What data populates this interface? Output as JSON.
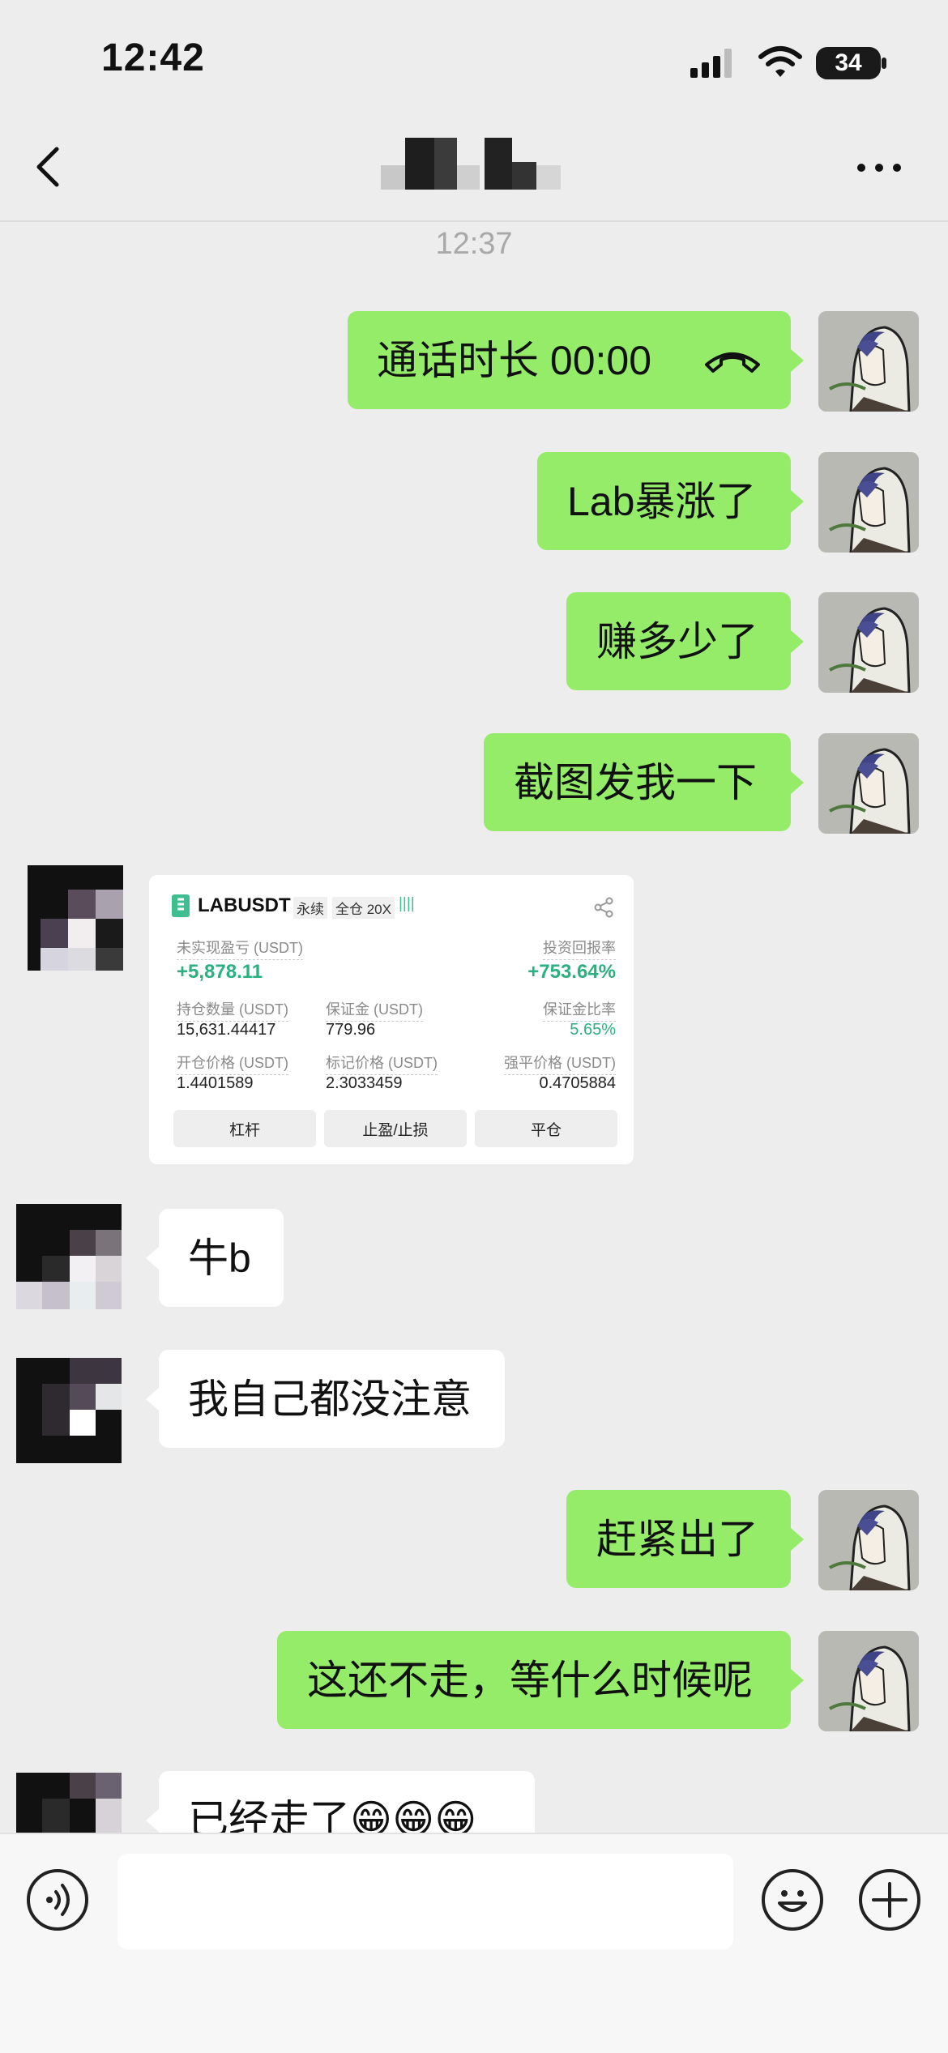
{
  "status_bar": {
    "time": "12:42",
    "battery": "34"
  },
  "chat": {
    "timestamp": "12:37",
    "messages": [
      {
        "side": "out",
        "text": "通话时长 00:00",
        "icon": "phone-hangup-icon"
      },
      {
        "side": "out",
        "text": "Lab暴涨了"
      },
      {
        "side": "out",
        "text": "赚多少了"
      },
      {
        "side": "out",
        "text": "截图发我一下"
      },
      {
        "side": "in",
        "type": "image"
      },
      {
        "side": "in",
        "text": "牛b"
      },
      {
        "side": "in",
        "text": "我自己都没注意"
      },
      {
        "side": "out",
        "text": "赶紧出了"
      },
      {
        "side": "out",
        "text": "这还不走，等什么时候呢"
      },
      {
        "side": "in",
        "text": "已经走了😁😁😁"
      }
    ]
  },
  "shared_screenshot": {
    "symbol": "LABUSDT",
    "tag_perpetual": "永续",
    "tag_margin": "全仓 20X",
    "bars": "||||",
    "unrealized_pnl_label": "未实现盈亏 (USDT)",
    "unrealized_pnl": "+5,878.11",
    "roi_label": "投资回报率",
    "roi": "+753.64%",
    "position_size_label": "持仓数量 (USDT)",
    "position_size": "15,631.44417",
    "margin_label": "保证金 (USDT)",
    "margin": "779.96",
    "margin_ratio_label": "保证金比率",
    "margin_ratio": "5.65%",
    "entry_price_label": "开仓价格 (USDT)",
    "entry_price": "1.4401589",
    "mark_price_label": "标记价格 (USDT)",
    "mark_price": "2.3033459",
    "liq_price_label": "强平价格 (USDT)",
    "liq_price": "0.4705884",
    "btn_leverage": "杠杆",
    "btn_tpsl": "止盈/止损",
    "btn_close": "平仓"
  },
  "colors": {
    "outgoing_bubble": "#95ec69",
    "incoming_bubble": "#ffffff",
    "background": "#ededed",
    "profit_green": "#2bb07f"
  }
}
